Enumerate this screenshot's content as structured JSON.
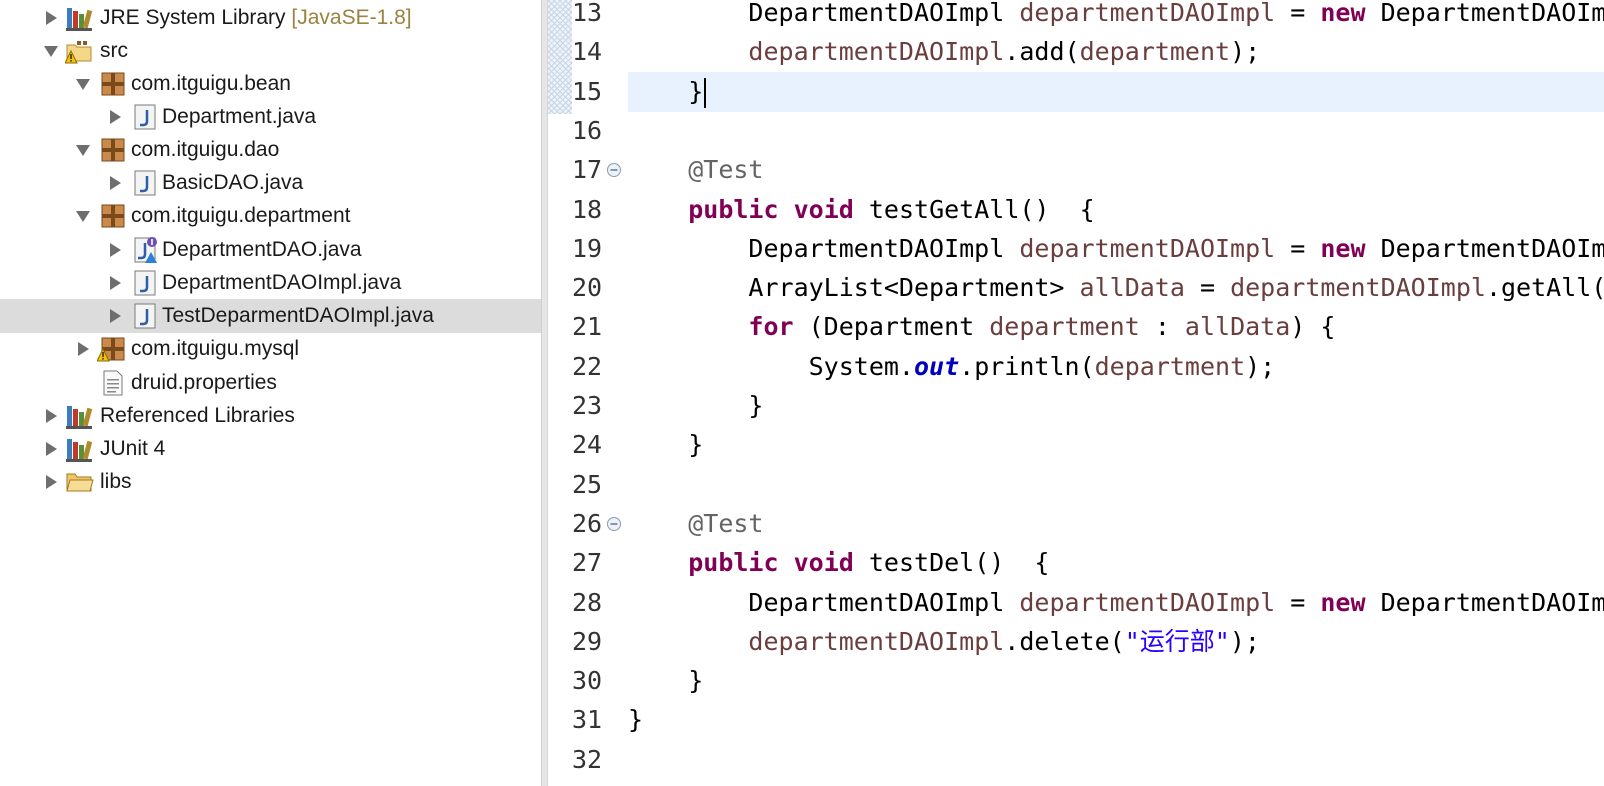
{
  "explorer": {
    "items": [
      {
        "label": "JRE System Library",
        "decoration": "[JavaSE-1.8]",
        "icon": "library-icon",
        "expanded": false
      },
      {
        "label": "src",
        "icon": "source-folder-warning-icon",
        "expanded": true
      },
      {
        "label": "com.itguigu.bean",
        "icon": "package-icon",
        "expanded": true
      },
      {
        "label": "Department.java",
        "icon": "java-file-icon",
        "expanded": false
      },
      {
        "label": "com.itguigu.dao",
        "icon": "package-icon",
        "expanded": true
      },
      {
        "label": "BasicDAO.java",
        "icon": "java-file-icon",
        "expanded": false
      },
      {
        "label": "com.itguigu.department",
        "icon": "package-icon",
        "expanded": true
      },
      {
        "label": "DepartmentDAO.java",
        "icon": "java-interface-file-icon",
        "expanded": false
      },
      {
        "label": "DepartmentDAOImpl.java",
        "icon": "java-file-icon",
        "expanded": false
      },
      {
        "label": "TestDeparmentDAOImpl.java",
        "icon": "java-file-icon",
        "expanded": false,
        "selected": true
      },
      {
        "label": "com.itguigu.mysql",
        "icon": "package-warning-icon",
        "expanded": false
      },
      {
        "label": "druid.properties",
        "icon": "text-file-icon"
      },
      {
        "label": "Referenced Libraries",
        "icon": "library-icon",
        "expanded": false
      },
      {
        "label": "JUnit 4",
        "icon": "library-icon",
        "expanded": false
      },
      {
        "label": "libs",
        "icon": "folder-icon",
        "expanded": false
      }
    ]
  },
  "editor": {
    "colors": {
      "keyword": "#7f0055",
      "variable": "#6a3e3e",
      "annotation": "#646464",
      "string": "#2a00ff",
      "current_line": "#e8f2fe"
    },
    "lines": [
      {
        "num": "13",
        "parts": [
          [
            "t",
            "        DepartmentDAOImpl "
          ],
          [
            "v",
            "departmentDAOImpl"
          ],
          [
            "t",
            " = "
          ],
          [
            "k",
            "new"
          ],
          [
            "t",
            " DepartmentDAOImpl();"
          ]
        ]
      },
      {
        "num": "14",
        "parts": [
          [
            "t",
            "        "
          ],
          [
            "v",
            "departmentDAOImpl"
          ],
          [
            "t",
            ".add("
          ],
          [
            "v",
            "department"
          ],
          [
            "t",
            ");"
          ]
        ]
      },
      {
        "num": "15",
        "parts": [
          [
            "t",
            "    }"
          ]
        ],
        "current": true
      },
      {
        "num": "16",
        "parts": []
      },
      {
        "num": "17",
        "parts": [
          [
            "t",
            "    "
          ],
          [
            "a",
            "@Test"
          ]
        ],
        "fold": true
      },
      {
        "num": "18",
        "parts": [
          [
            "t",
            "    "
          ],
          [
            "k",
            "public"
          ],
          [
            "t",
            " "
          ],
          [
            "k",
            "void"
          ],
          [
            "t",
            " testGetAll()  {"
          ]
        ]
      },
      {
        "num": "19",
        "parts": [
          [
            "t",
            "        DepartmentDAOImpl "
          ],
          [
            "v",
            "departmentDAOImpl"
          ],
          [
            "t",
            " = "
          ],
          [
            "k",
            "new"
          ],
          [
            "t",
            " DepartmentDAOImpl();"
          ]
        ]
      },
      {
        "num": "20",
        "parts": [
          [
            "t",
            "        ArrayList<Department> "
          ],
          [
            "v",
            "allData"
          ],
          [
            "t",
            " = "
          ],
          [
            "v",
            "departmentDAOImpl"
          ],
          [
            "t",
            ".getAll();"
          ]
        ]
      },
      {
        "num": "21",
        "parts": [
          [
            "t",
            "        "
          ],
          [
            "k",
            "for"
          ],
          [
            "t",
            " (Department "
          ],
          [
            "v",
            "department"
          ],
          [
            "t",
            " : "
          ],
          [
            "v",
            "allData"
          ],
          [
            "t",
            ") {"
          ]
        ]
      },
      {
        "num": "22",
        "parts": [
          [
            "t",
            "            System."
          ],
          [
            "s",
            "out"
          ],
          [
            "t",
            ".println("
          ],
          [
            "v",
            "department"
          ],
          [
            "t",
            ");"
          ]
        ]
      },
      {
        "num": "23",
        "parts": [
          [
            "t",
            "        }"
          ]
        ]
      },
      {
        "num": "24",
        "parts": [
          [
            "t",
            "    }"
          ]
        ]
      },
      {
        "num": "25",
        "parts": []
      },
      {
        "num": "26",
        "parts": [
          [
            "t",
            "    "
          ],
          [
            "a",
            "@Test"
          ]
        ],
        "fold": true
      },
      {
        "num": "27",
        "parts": [
          [
            "t",
            "    "
          ],
          [
            "k",
            "public"
          ],
          [
            "t",
            " "
          ],
          [
            "k",
            "void"
          ],
          [
            "t",
            " testDel()  {"
          ]
        ]
      },
      {
        "num": "28",
        "parts": [
          [
            "t",
            "        DepartmentDAOImpl "
          ],
          [
            "v",
            "departmentDAOImpl"
          ],
          [
            "t",
            " = "
          ],
          [
            "k",
            "new"
          ],
          [
            "t",
            " DepartmentDAOImpl();"
          ]
        ]
      },
      {
        "num": "29",
        "parts": [
          [
            "t",
            "        "
          ],
          [
            "v",
            "departmentDAOImpl"
          ],
          [
            "t",
            ".delete("
          ],
          [
            "q",
            "\"运行部\""
          ],
          [
            "t",
            ");"
          ]
        ]
      },
      {
        "num": "30",
        "parts": [
          [
            "t",
            "    }"
          ]
        ]
      },
      {
        "num": "31",
        "parts": [
          [
            "t",
            "}"
          ]
        ]
      },
      {
        "num": "32",
        "parts": []
      }
    ]
  }
}
